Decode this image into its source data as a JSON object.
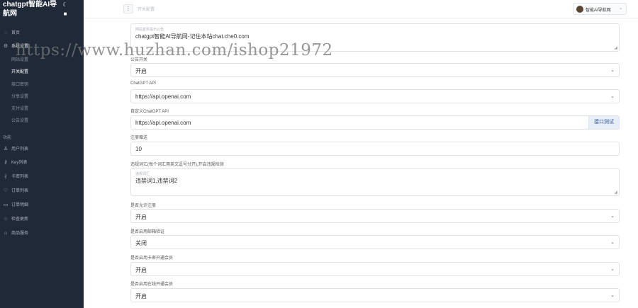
{
  "sidebar": {
    "brand": "chatgpt智能AI导航网",
    "moon_icon": "moon-icon",
    "items": [
      {
        "label": "首页",
        "icon": "home-icon"
      },
      {
        "label": "系统设置",
        "icon": "settings-icon"
      },
      {
        "label": "网站设置"
      },
      {
        "label": "开关配置"
      },
      {
        "label": "接口密钥"
      },
      {
        "label": "分享设置"
      },
      {
        "label": "支付设置"
      },
      {
        "label": "公告设置"
      }
    ],
    "section_label": "功能",
    "section_items": [
      {
        "label": "用户列表",
        "icon": "user-icon"
      },
      {
        "label": "Key列表",
        "icon": "key-icon"
      },
      {
        "label": "卡密列表",
        "icon": "card-icon"
      },
      {
        "label": "订单列表",
        "icon": "heart-icon"
      },
      {
        "label": "订单明细",
        "icon": "doc-icon"
      },
      {
        "label": "检查更新",
        "icon": "refresh-icon"
      },
      {
        "label": "商品服务",
        "icon": "cart-icon"
      }
    ]
  },
  "header": {
    "menu_icon": "menu-icon",
    "breadcrumb": "开关配置",
    "user_name": "智能AI导航网",
    "chevron": "chevron-down-icon"
  },
  "form": {
    "notice": {
      "placeholder": "网站首页提示公告",
      "value": "chatgpt智能AI导航网-记住本站chat.che0.com"
    },
    "announcement_switch": {
      "label": "公告开关",
      "value": "开启"
    },
    "chatgpt_api": {
      "label": "ChatGPT API",
      "value": "https://api.openai.com"
    },
    "custom_api": {
      "label": "自定义ChatGPT API",
      "value": "https://api.openai.com",
      "button": "接口测试"
    },
    "free_count": {
      "label": "注册赠送",
      "value": "10"
    },
    "sensitive": {
      "label": "违规词汇(每个词汇用英文逗号分开),开启违规检测",
      "placeholder": "违规词汇",
      "value": "违禁词1,违禁词2"
    },
    "allow_register": {
      "label": "是否允许注册",
      "value": "开启"
    },
    "email_verify": {
      "label": "是否启用邮箱验证",
      "value": "关闭"
    },
    "card_member": {
      "label": "是否启用卡密开通会员",
      "value": "开启"
    },
    "online_member": {
      "label": "是否启用在线开通会员",
      "value": "开启"
    }
  },
  "watermark": "https://www.huzhan.com/ishop21972"
}
